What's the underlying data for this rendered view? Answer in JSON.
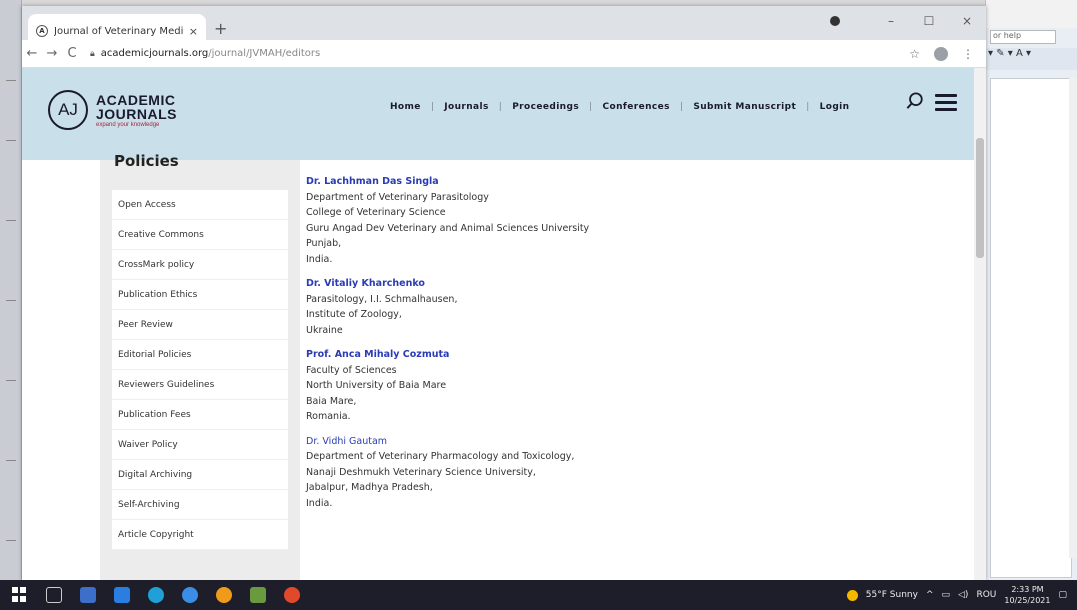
{
  "browser": {
    "tab_title": "Journal of Veterinary Medicine a",
    "tab_close": "×",
    "new_tab": "+",
    "url_host": "academicjournals.org",
    "url_path": "/journal/JVMAH/editors",
    "window_controls": {
      "minimize": "–",
      "maximize": "☐",
      "close": "×"
    }
  },
  "site": {
    "logo_mark": "AJ",
    "logo_line1": "ACADEMIC",
    "logo_line2": "JOURNALS",
    "logo_tagline": "expand your knowledge",
    "nav": [
      "Home",
      "Journals",
      "Proceedings",
      "Conferences",
      "Submit Manuscript",
      "Login"
    ],
    "nav_separator": "|"
  },
  "sidebar": {
    "title": "Policies",
    "items": [
      "Open Access",
      "Creative Commons",
      "CrossMark policy",
      "Publication Ethics",
      "Peer Review",
      "Editorial Policies",
      "Reviewers Guidelines",
      "Publication Fees",
      "Waiver Policy",
      "Digital Archiving",
      "Self-Archiving",
      "Article Copyright"
    ]
  },
  "editors": [
    {
      "name": "Dr. Lachhman Das Singla",
      "lines": [
        "Department of Veterinary Parasitology",
        "College of Veterinary Science",
        "Guru Angad Dev Veterinary and Animal Sciences University",
        "Punjab,",
        "India."
      ]
    },
    {
      "name": "Dr. Vitaliy Kharchenko",
      "lines": [
        "Parasitology, I.I. Schmalhausen,",
        "Institute of Zoology,",
        "Ukraine"
      ]
    },
    {
      "name": "Prof. Anca Mihaly Cozmuta",
      "lines": [
        "Faculty of Sciences",
        "North University of Baia Mare",
        "Baia Mare,",
        "Romania."
      ]
    },
    {
      "name": "Dr. Vidhi Gautam",
      "lines": [
        "Department of Veterinary Pharmacology and Toxicology,",
        "Nanaji Deshmukh Veterinary Science University,",
        "Jabalpur, Madhya Pradesh,",
        "India."
      ]
    }
  ],
  "background_app": {
    "help_placeholder": "or help"
  },
  "taskbar": {
    "weather": "55°F Sunny",
    "lang": "ROU",
    "time": "2:33 PM",
    "date": "10/25/2021"
  },
  "colors": {
    "header_bg": "#c9e0ea",
    "editor_name": "#2a3bb5",
    "logo_tagline": "#b0233c"
  }
}
